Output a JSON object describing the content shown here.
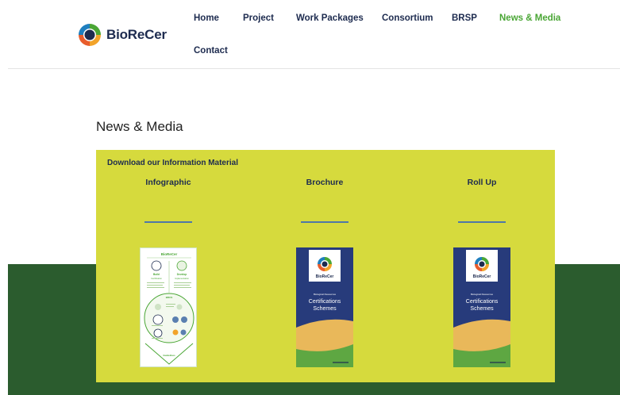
{
  "header": {
    "brand": "BioReCer",
    "nav": [
      {
        "label": "Home"
      },
      {
        "label": "Project"
      },
      {
        "label": "Work Packages"
      },
      {
        "label": "Consortium"
      },
      {
        "label": "BRSP"
      },
      {
        "label": "News & Media",
        "active": true
      },
      {
        "label": "Contact"
      }
    ]
  },
  "main": {
    "title": "News & Media",
    "section_heading": "Download our Information Material",
    "items": [
      {
        "label": "Infographic"
      },
      {
        "label": "Brochure"
      },
      {
        "label": "Roll Up"
      }
    ],
    "thumbnails": {
      "infographic": {
        "brand": "BioReCer",
        "block1_title": "Build",
        "block1_subtitle": "Certification",
        "block2_title": "Develop",
        "block2_subtitle": "Implementation",
        "center_label": "BRCS",
        "footer": "Guidelines"
      },
      "brochure": {
        "brand": "BioReCer",
        "overline": "Biological Resources",
        "line1": "Certifications",
        "line2": "Schemes"
      },
      "rollup": {
        "brand": "BioReCer",
        "overline": "Biological Resources",
        "line1": "Certifications",
        "line2": "Schemes"
      }
    }
  },
  "colors": {
    "navy": "#1d2b4f",
    "accent_green": "#4aa635",
    "panel_yellow": "#d6da3d",
    "band_green": "#2b5c2e",
    "rule_blue": "#4f78a8"
  }
}
